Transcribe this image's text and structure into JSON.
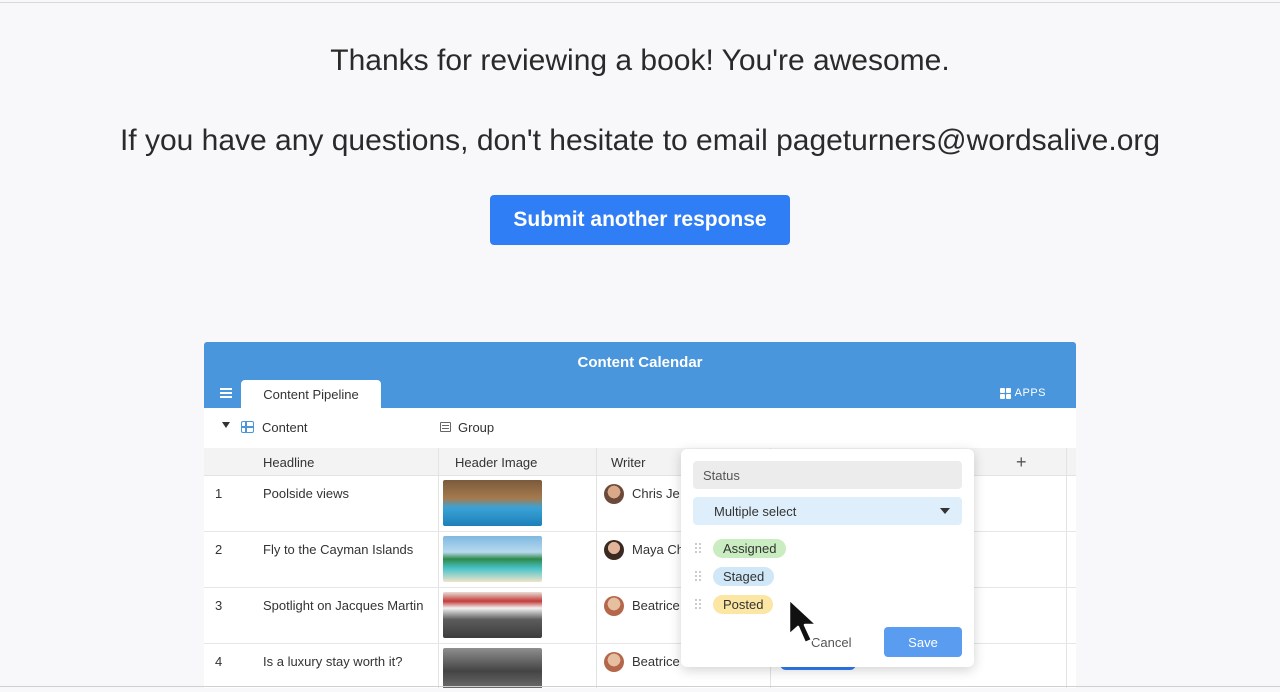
{
  "message": {
    "thanks": "Thanks for reviewing a book! You're awesome.",
    "questions": "If you have any questions, don't hesitate to email pageturners@wordsalive.org"
  },
  "submit_button": {
    "label": "Submit another response"
  },
  "preview": {
    "title": "Content Calendar",
    "tab": "Content Pipeline",
    "apps_label": "APPS",
    "toolbar": {
      "table_label": "Content",
      "group_label": "Group"
    },
    "columns": [
      "Headline",
      "Header Image",
      "Writer"
    ],
    "add_column": "+",
    "rows": [
      {
        "num": "1",
        "headline": "Poolside views",
        "writer": "Chris Je"
      },
      {
        "num": "2",
        "headline": "Fly to the Cayman Islands",
        "writer": "Maya Ch"
      },
      {
        "num": "3",
        "headline": "Spotlight on Jacques Martin",
        "writer": "Beatrice"
      },
      {
        "num": "4",
        "headline": "Is a luxury stay worth it?",
        "writer": "Beatrice"
      }
    ],
    "popup": {
      "field_name": "Status",
      "field_type": "Multiple select",
      "options": [
        "Assigned",
        "Staged",
        "Posted"
      ],
      "cancel": "Cancel",
      "save": "Save"
    }
  },
  "colors": {
    "primary_button": "#2f7ef5",
    "preview_header": "#4a96dc"
  },
  "icons": [
    "hamburger-icon",
    "apps-icon",
    "grid-icon",
    "group-icon",
    "caret-down-icon",
    "drag-handle-icon",
    "cursor-pointer-icon"
  ]
}
